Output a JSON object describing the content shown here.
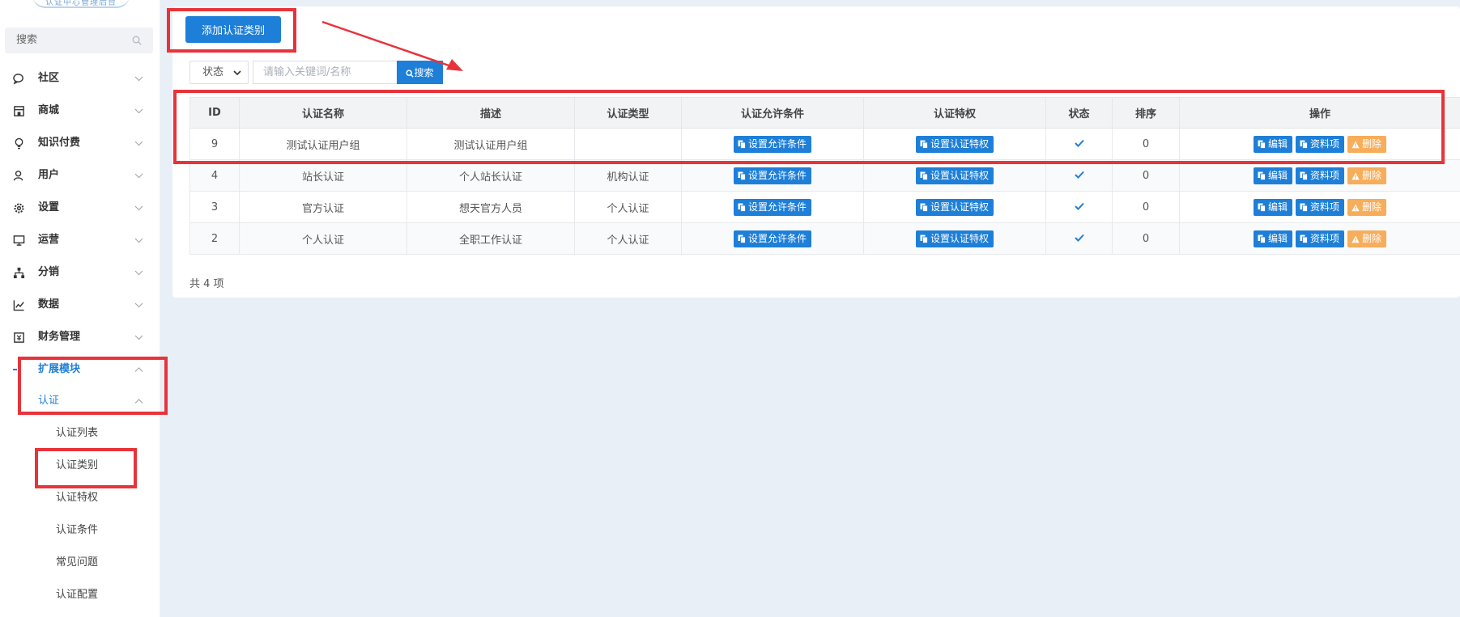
{
  "sidebar": {
    "logo_text": "认证中心管理后台",
    "search_placeholder": "搜索",
    "items": [
      {
        "label": "社区",
        "icon": "chat-icon"
      },
      {
        "label": "商城",
        "icon": "store-icon"
      },
      {
        "label": "知识付费",
        "icon": "bulb-icon"
      },
      {
        "label": "用户",
        "icon": "user-icon"
      },
      {
        "label": "设置",
        "icon": "gear-icon"
      },
      {
        "label": "运营",
        "icon": "monitor-icon"
      },
      {
        "label": "分销",
        "icon": "sitemap-icon"
      },
      {
        "label": "数据",
        "icon": "chart-icon"
      },
      {
        "label": "财务管理",
        "icon": "finance-icon"
      },
      {
        "label": "扩展模块",
        "icon": "extension-icon",
        "active": true
      }
    ],
    "group_label": "认证",
    "sub_items": [
      "认证列表",
      "认证类别",
      "认证特权",
      "认证条件",
      "常见问题",
      "认证配置"
    ]
  },
  "toolbar": {
    "add_label": "添加认证类别",
    "status_label": "状态",
    "search_placeholder": "请输入关键词/名称",
    "search_label": "搜索"
  },
  "table": {
    "columns": [
      "ID",
      "认证名称",
      "描述",
      "认证类型",
      "认证允许条件",
      "认证特权",
      "状态",
      "排序",
      "操作"
    ],
    "rows": [
      {
        "id": "9",
        "name": "测试认证用户组",
        "desc": "测试认证用户组",
        "type": "",
        "condition_btn": "设置允许条件",
        "privilege_btn": "设置认证特权",
        "enabled": true,
        "sort": "0"
      },
      {
        "id": "4",
        "name": "站长认证",
        "desc": "个人站长认证",
        "type": "机构认证",
        "condition_btn": "设置允许条件",
        "privilege_btn": "设置认证特权",
        "enabled": true,
        "sort": "0"
      },
      {
        "id": "3",
        "name": "官方认证",
        "desc": "想天官方人员",
        "type": "个人认证",
        "condition_btn": "设置允许条件",
        "privilege_btn": "设置认证特权",
        "enabled": true,
        "sort": "0"
      },
      {
        "id": "2",
        "name": "个人认证",
        "desc": "全职工作认证",
        "type": "个人认证",
        "condition_btn": "设置允许条件",
        "privilege_btn": "设置认证特权",
        "enabled": true,
        "sort": "0"
      }
    ],
    "actions": {
      "edit": "编辑",
      "profile": "资料项",
      "delete": "删除"
    },
    "total_text": "共 4 项"
  },
  "colors": {
    "accent": "#1e7fd8",
    "warning": "#f7ad5a",
    "highlight": "#e8333a",
    "page_bg": "#e9eff6"
  }
}
